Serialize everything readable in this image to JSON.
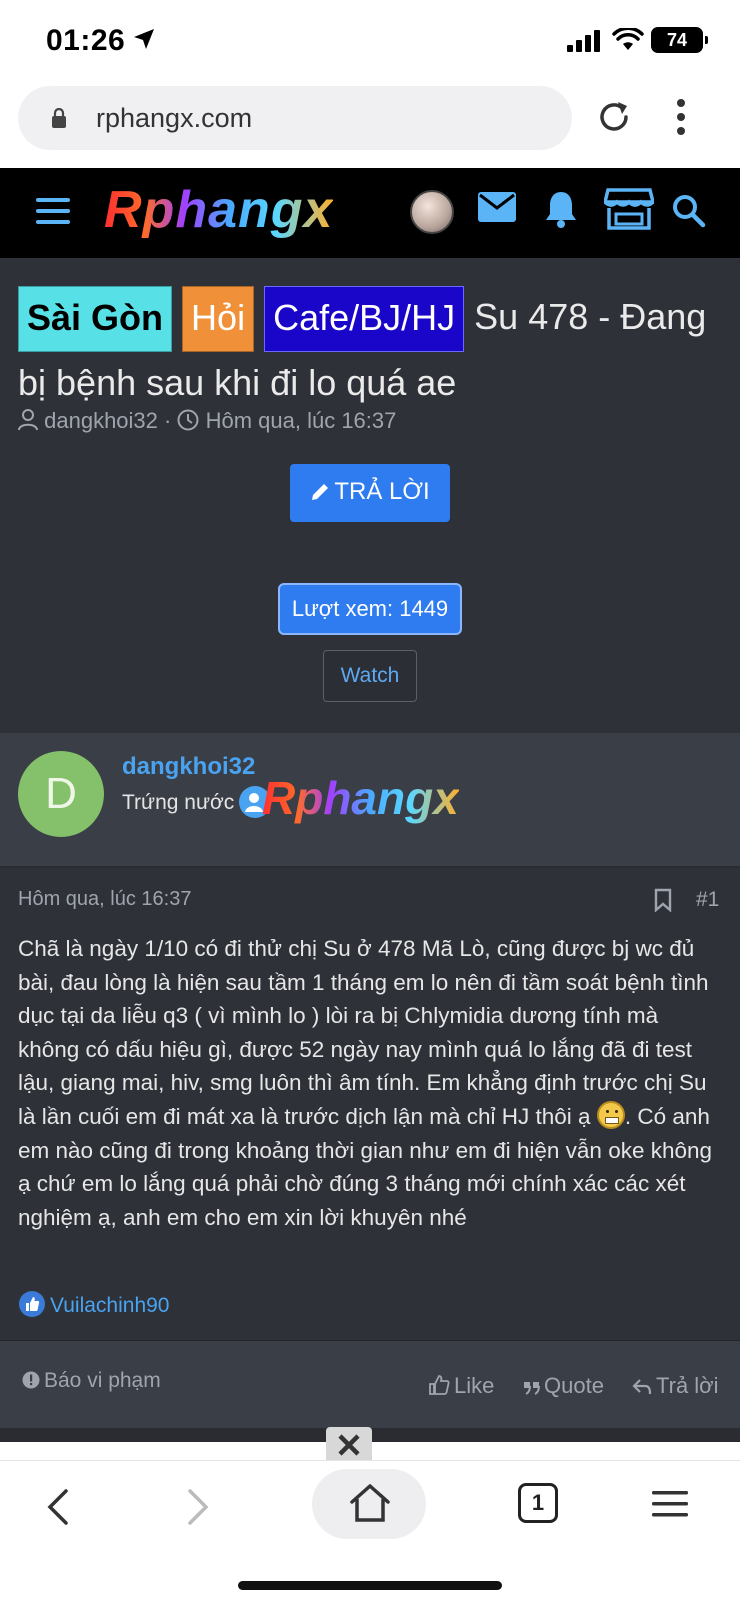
{
  "status_bar": {
    "time": "01:26",
    "battery": "74"
  },
  "browser": {
    "url": "rphangx.com",
    "tab_count": "1"
  },
  "site": {
    "logo_text": "Rphangx"
  },
  "thread": {
    "tags": [
      "Sài Gòn",
      "Hỏi",
      "Cafe/BJ/HJ"
    ],
    "title": "Su 478 - Đang bị bệnh sau khi đi lo quá ae",
    "author": "dangkhoi32",
    "date": "Hôm qua, lúc 16:37",
    "reply_button": "TRẢ LỜI",
    "views_label": "Lượt xem: 1449",
    "watch_button": "Watch"
  },
  "post": {
    "avatar_letter": "D",
    "username": "dangkhoi32",
    "user_title": "Trứng nước",
    "banner_text": "Rphangx",
    "date": "Hôm qua, lúc 16:37",
    "number": "#1",
    "body_part1": "Chã là ngày 1/10 có đi thử chị Su ở 478 Mã Lò, cũng được bj wc đủ bài, đau lòng là hiện sau tầm 1 tháng em lo nên đi tầm soát bệnh tình dục tại da liễu q3 ( vì mình lo ) lòi ra bị Chlymidia dương tính mà không có dấu hiệu gì, được 52 ngày nay mình quá lo lắng đã đi test lậu, giang mai, hiv, smg luôn thì âm tính. Em khẳng định trước chị Su là lần cuối em đi mát xa là trước dịch lận mà chỉ HJ thôi ạ ",
    "body_part2": ". Có anh em nào cũng đi trong khoảng thời gian như em đi hiện vẫn oke không ạ chứ em lo lắng quá phải chờ đúng 3 tháng mới chính xác các xét nghiệm ạ, anh em cho em xin lời khuyên nhé",
    "reaction_user": "Vuilachinh90",
    "report_label": "Báo vi phạm",
    "like_label": "Like",
    "quote_label": "Quote",
    "reply_label": "Trả lời"
  }
}
